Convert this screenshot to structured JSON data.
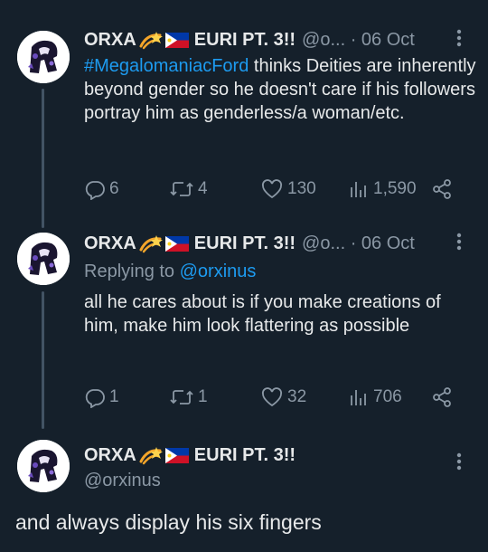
{
  "tweets": [
    {
      "name": "ORXA",
      "handle_time": "@o... · 06 Oct",
      "hashtag": "#MegalomaniacFord",
      "text": " thinks Deities are inherently beyond gender so he doesn't care if his followers portray him as genderless/a woman/etc.",
      "replies": "6",
      "retweets": "4",
      "likes": "130",
      "views": "1,590"
    },
    {
      "name": "ORXA",
      "handle_time": "@o... · 06 Oct",
      "replying_prefix": "Replying to ",
      "replying_handle": "@orxinus",
      "text": "all he cares about is if you make creations of him, make him look flattering as possible",
      "replies": "1",
      "retweets": "1",
      "likes": "32",
      "views": "706"
    },
    {
      "name": "ORXA",
      "handle": "@orxinus",
      "text": "and always display his six fingers"
    }
  ],
  "name_suffix": "EURI PT. 3!!",
  "icons": [
    "more-vertical-icon",
    "reply-icon",
    "retweet-icon",
    "like-icon",
    "views-icon",
    "share-icon",
    "dizzy-emoji-icon",
    "philippines-flag-icon"
  ],
  "colors": {
    "background": "#15202b",
    "text": "#e7e9ea",
    "muted": "#8b98a5",
    "link": "#1d9bf0"
  }
}
